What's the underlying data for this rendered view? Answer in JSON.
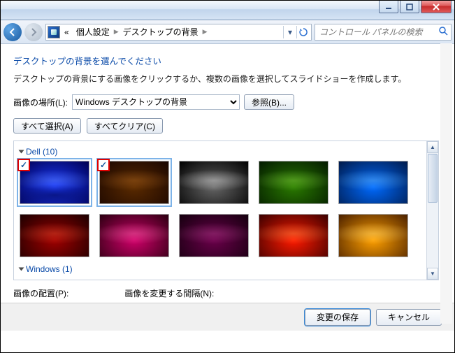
{
  "titlebar": {
    "minimize": "minimize",
    "maximize": "maximize",
    "close": "close"
  },
  "nav": {
    "breadcrumb_prefix": "«",
    "crumb1": "個人設定",
    "crumb2": "デスクトップの背景",
    "search_placeholder": "コントロール パネルの検索"
  },
  "content": {
    "instr_title": "デスクトップの背景を選んでください",
    "instr_text": "デスクトップの背景にする画像をクリックするか、複数の画像を選択してスライドショーを作成します。",
    "location_label": "画像の場所(L):",
    "location_value": "Windows デスクトップの背景",
    "browse_btn": "参照(B)...",
    "select_all_btn": "すべて選択(A)",
    "clear_all_btn": "すべてクリア(C)",
    "group1_name": "Dell (10)",
    "group2_name": "Windows (1)",
    "position_label": "画像の配置(P):",
    "interval_label": "画像を変更する間隔(N):"
  },
  "footer": {
    "save_btn": "変更の保存",
    "cancel_btn": "キャンセル"
  },
  "thumbnails": [
    {
      "id": "blue",
      "selected": true
    },
    {
      "id": "brown",
      "selected": true
    },
    {
      "id": "gray",
      "selected": false
    },
    {
      "id": "green",
      "selected": false
    },
    {
      "id": "blue2",
      "selected": false
    },
    {
      "id": "red",
      "selected": false
    },
    {
      "id": "pink",
      "selected": false
    },
    {
      "id": "purple",
      "selected": false
    },
    {
      "id": "redb",
      "selected": false
    },
    {
      "id": "orange",
      "selected": false
    }
  ]
}
